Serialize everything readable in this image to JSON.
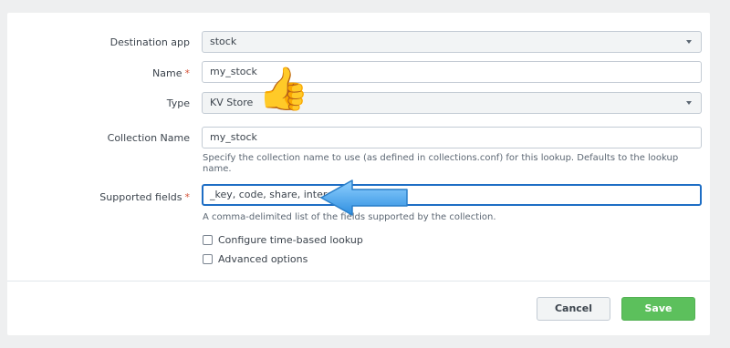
{
  "form": {
    "destination_app": {
      "label": "Destination app",
      "value": "stock"
    },
    "name": {
      "label": "Name",
      "required_mark": "*",
      "value": "my_stock"
    },
    "type": {
      "label": "Type",
      "value": "KV Store"
    },
    "collection_name": {
      "label": "Collection Name",
      "value": "my_stock",
      "help": "Specify the collection name to use (as defined in collections.conf) for this lookup. Defaults to the lookup name."
    },
    "supported_fields": {
      "label": "Supported fields",
      "required_mark": "*",
      "value": "_key, code, share, interest",
      "help": "A comma-delimited list of the fields supported by the collection."
    },
    "time_lookup": {
      "label": "Configure time-based lookup",
      "checked": false
    },
    "advanced": {
      "label": "Advanced options",
      "checked": false
    }
  },
  "footer": {
    "cancel_label": "Cancel",
    "save_label": "Save"
  },
  "overlay": {
    "thumbs_up": "👍",
    "arrow_color": "#4aa8f0"
  },
  "colors": {
    "save_green": "#5cc05c",
    "focus_blue": "#1e6ec5",
    "required_red": "#d6563c"
  }
}
